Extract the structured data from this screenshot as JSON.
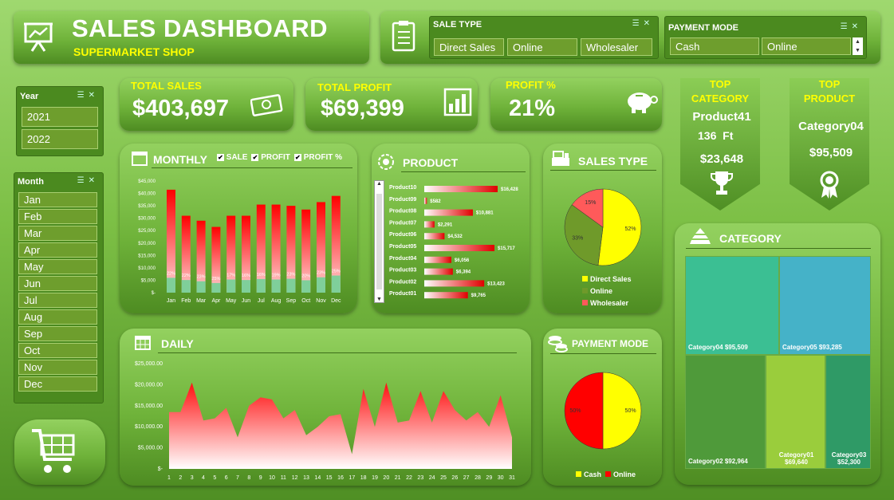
{
  "header": {
    "title": "SALES DASHBOARD",
    "subtitle": "SUPERMARKET SHOP"
  },
  "sale_type": {
    "title": "SALE TYPE",
    "options": [
      "Direct Sales",
      "Online",
      "Wholesaler"
    ]
  },
  "payment_mode_slicer": {
    "title": "PAYMENT MODE",
    "options": [
      "Cash",
      "Online"
    ]
  },
  "year": {
    "title": "Year",
    "options": [
      "2021",
      "2022"
    ]
  },
  "month": {
    "title": "Month",
    "options": [
      "Jan",
      "Feb",
      "Mar",
      "Apr",
      "May",
      "Jun",
      "Jul",
      "Aug",
      "Sep",
      "Oct",
      "Nov",
      "Dec"
    ]
  },
  "kpi": {
    "total_sales": {
      "label": "TOTAL SALES",
      "value": "$403,697"
    },
    "total_profit": {
      "label": "TOTAL PROFIT",
      "value": "$69,399"
    },
    "profit_pct": {
      "label": "PROFIT %",
      "value": "21%"
    }
  },
  "top_category": {
    "label1": "TOP",
    "label2": "CATEGORY",
    "name": "Product41",
    "qty": "136",
    "unit": "Ft",
    "value": "$23,648"
  },
  "top_product": {
    "label1": "TOP",
    "label2": "PRODUCT",
    "name": "Category04",
    "value": "$95,509"
  },
  "monthly": {
    "title": "MONTHLY",
    "legend": [
      "SALE",
      "PROFIT",
      "PROFIT %"
    ]
  },
  "product": {
    "title": "PRODUCT"
  },
  "sales_type": {
    "title": "SALES TYPE"
  },
  "daily": {
    "title": "DAILY"
  },
  "payment": {
    "title": "PAYMENT MODE"
  },
  "category": {
    "title": "CATEGORY"
  },
  "chart_data": [
    {
      "type": "bar",
      "name": "monthly",
      "categories": [
        "Jan",
        "Feb",
        "Mar",
        "Apr",
        "May",
        "Jun",
        "Jul",
        "Aug",
        "Sep",
        "Oct",
        "Nov",
        "Dec"
      ],
      "series": [
        {
          "name": "SALE",
          "values": [
            41500,
            31000,
            29000,
            26500,
            31000,
            31000,
            35500,
            35500,
            35000,
            33500,
            36500,
            39000
          ]
        },
        {
          "name": "PROFIT",
          "values": [
            6000,
            5100,
            4600,
            3900,
            5300,
            5100,
            5500,
            5300,
            5600,
            5000,
            6200,
            6900
          ]
        }
      ],
      "data_labels": [
        "22%",
        "22%",
        "23%",
        "25%",
        "17%",
        "16%",
        "16%",
        "19%",
        "23%",
        "20%",
        "23%",
        "25%"
      ],
      "yticks": [
        "$45,000",
        "$40,000",
        "$35,000",
        "$30,000",
        "$25,000",
        "$20,000",
        "$15,000",
        "$10,000",
        "$5,000",
        "$-"
      ],
      "ylim": [
        0,
        45000
      ]
    },
    {
      "type": "bar",
      "name": "product",
      "categories": [
        "Product10",
        "Product09",
        "Product08",
        "Product07",
        "Product06",
        "Product05",
        "Product04",
        "Product03",
        "Product02",
        "Product01"
      ],
      "values": [
        16428,
        582,
        10881,
        2291,
        4532,
        15717,
        6056,
        6394,
        13423,
        9765
      ],
      "labels": [
        "$16,428",
        "$582",
        "$10,881",
        "$2,291",
        "$4,532",
        "$15,717",
        "$6,056",
        "$6,394",
        "$13,423",
        "$9,765"
      ]
    },
    {
      "type": "pie",
      "name": "sales_type",
      "labels": [
        "Direct Sales",
        "Online",
        "Wholesaler"
      ],
      "values": [
        52,
        33,
        15
      ],
      "display": [
        "52%",
        "33%",
        "15%"
      ],
      "colors": [
        "#ffff00",
        "#6f9a2a",
        "#ff5a5a"
      ]
    },
    {
      "type": "area",
      "name": "daily",
      "x": [
        1,
        2,
        3,
        4,
        5,
        6,
        7,
        8,
        9,
        10,
        11,
        12,
        13,
        14,
        15,
        16,
        17,
        18,
        19,
        20,
        21,
        22,
        23,
        24,
        25,
        26,
        27,
        28,
        29,
        30,
        31
      ],
      "values": [
        13500,
        13500,
        20500,
        11500,
        12000,
        14500,
        7500,
        15000,
        17000,
        16500,
        12000,
        14000,
        8000,
        10000,
        12500,
        13000,
        3500,
        19000,
        10000,
        20500,
        11000,
        11500,
        18500,
        11000,
        18500,
        14000,
        11500,
        13500,
        10000,
        17500,
        7500
      ],
      "yticks": [
        "$25,000.00",
        "$20,000.00",
        "$15,000.00",
        "$10,000.00",
        "$5,000.00",
        "$-"
      ],
      "ylim": [
        0,
        25000
      ]
    },
    {
      "type": "pie",
      "name": "payment_mode",
      "labels": [
        "Cash",
        "Online"
      ],
      "values": [
        50,
        50
      ],
      "display": [
        "50%",
        "50%"
      ],
      "colors": [
        "#ffff00",
        "#ff0000"
      ]
    },
    {
      "type": "treemap",
      "name": "category",
      "items": [
        {
          "name": "Category04",
          "value": "$95,509",
          "color": "#3bbf93"
        },
        {
          "name": "Category05",
          "value": "$93,285",
          "color": "#45b2c8"
        },
        {
          "name": "Category02",
          "value": "$92,964",
          "color": "#4f9a3a"
        },
        {
          "name": "Category01",
          "value": "$69,640",
          "color": "#9acd3c"
        },
        {
          "name": "Category03",
          "value": "$52,300",
          "color": "#2f9a66"
        }
      ]
    }
  ]
}
